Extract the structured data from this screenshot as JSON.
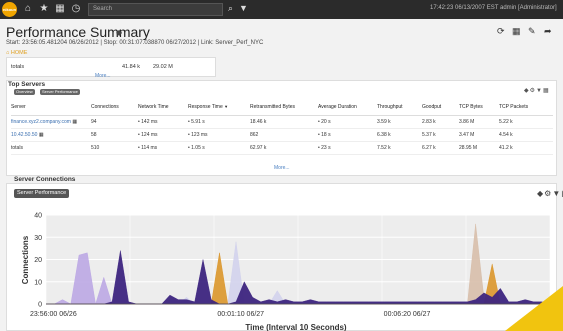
{
  "nav": {
    "logo_text": "nikoun",
    "search_placeholder": "Search",
    "clock": "17:42:23 06/13/2007 EST",
    "user": "admin [Administrator]"
  },
  "header": {
    "title": "Performance Summary",
    "subtitle": "Start: 23:56:05.481204 06/26/2012 | Stop: 00:31:07.038870 06/27/2012 | Link: Server_Perf_NYC",
    "crumb": "HOME"
  },
  "totals_strip": {
    "label": "totals",
    "v1": "41.84 k",
    "v2": "29.02 M",
    "more": "More..."
  },
  "top_servers": {
    "title": "Top Servers",
    "pills": [
      "Overview",
      "Server Performance"
    ],
    "columns": [
      "Server",
      "Connections",
      "Network Time",
      "Response Time",
      "Retransmitted Bytes",
      "Average Duration",
      "Throughput",
      "Goodput",
      "TCP Bytes",
      "TCP Packets"
    ],
    "rows": [
      [
        "finance.xyz2.company.com",
        "94",
        "142 ms",
        "5.91 s",
        "18.46 k",
        "20 s",
        "3.59 k",
        "2.83 k",
        "3.86 M",
        "5.22 k"
      ],
      [
        "10.42.50.50",
        "58",
        "124 ms",
        "123 ms",
        "862",
        "18 s",
        "6.38 k",
        "5.37 k",
        "3.47 M",
        "4.54 k"
      ],
      [
        "totals",
        "510",
        "114 ms",
        "1.05 s",
        "62.97 k",
        "23 s",
        "7.52 k",
        "6.27 k",
        "28.95 M",
        "41.2 k"
      ]
    ],
    "more": "More..."
  },
  "connections": {
    "section_title": "Server Connections",
    "tab": "Server Performance"
  },
  "chart_data": {
    "type": "area",
    "ylabel": "Connections",
    "xlabel": "Time (Interval 10 Seconds)",
    "ylim": [
      0,
      40
    ],
    "yticks": [
      0,
      10,
      20,
      30,
      40
    ],
    "xtick_labels": [
      "23:56:00 06/26",
      "00:01:10 06/27",
      "00:06:20 06/27"
    ],
    "grid": true,
    "series": [
      {
        "color": "#b9a3e3",
        "values": [
          0,
          0,
          2,
          0,
          22,
          23,
          0,
          12,
          0,
          0,
          0,
          0,
          0,
          0,
          0,
          0,
          0,
          0,
          0,
          0,
          0,
          0,
          0,
          0,
          0,
          0,
          0,
          0,
          0,
          0,
          0,
          0,
          0,
          0,
          0,
          0,
          0,
          0,
          0,
          0,
          0,
          0,
          0,
          0,
          0,
          0,
          0,
          0,
          0,
          0,
          0,
          0,
          0,
          0,
          0,
          0,
          0,
          0,
          0,
          0,
          0,
          0
        ]
      },
      {
        "color": "#d0d0ec",
        "values": [
          0,
          0,
          0,
          0,
          0,
          0,
          0,
          0,
          0,
          0,
          0,
          0,
          0,
          0,
          0,
          0,
          0,
          3,
          0,
          0,
          0,
          0,
          0,
          28,
          0,
          0,
          0,
          0,
          6,
          0,
          0,
          0,
          0,
          0,
          0,
          0,
          0,
          0,
          0,
          0,
          0,
          0,
          0,
          0,
          0,
          0,
          0,
          0,
          0,
          0,
          0,
          0,
          0,
          0,
          0,
          0,
          0,
          0,
          0,
          0,
          0,
          0
        ]
      },
      {
        "color": "#d6bba6",
        "values": [
          0,
          0,
          0,
          0,
          0,
          0,
          0,
          0,
          0,
          0,
          0,
          0,
          0,
          0,
          0,
          0,
          0,
          0,
          0,
          0,
          0,
          0,
          0,
          0,
          0,
          0,
          0,
          0,
          0,
          0,
          0,
          0,
          0,
          0,
          0,
          0,
          0,
          0,
          0,
          0,
          0,
          0,
          0,
          0,
          0,
          0,
          0,
          0,
          0,
          0,
          0,
          0,
          36,
          3,
          0,
          0,
          0,
          0,
          0,
          0,
          0,
          0
        ]
      },
      {
        "color": "#d9901f",
        "values": [
          0,
          0,
          0,
          0,
          0,
          0,
          0,
          0,
          0,
          0,
          0,
          0,
          0,
          0,
          0,
          0,
          0,
          0,
          0,
          0,
          0,
          23,
          0,
          0,
          0,
          0,
          0,
          0,
          0,
          0,
          0,
          0,
          0,
          0,
          0,
          0,
          0,
          0,
          0,
          0,
          0,
          0,
          0,
          0,
          0,
          0,
          0,
          0,
          0,
          0,
          0,
          0,
          0,
          0,
          18,
          0,
          0,
          0,
          0,
          0,
          0,
          0
        ]
      },
      {
        "color": "#3d2580",
        "values": [
          0,
          0,
          0,
          0,
          0,
          0,
          0,
          0,
          1,
          24,
          1,
          0,
          0,
          0,
          0,
          4,
          2,
          2,
          1,
          20,
          2,
          0,
          0,
          1,
          10,
          3,
          1,
          2,
          1,
          2,
          1,
          1,
          2,
          1,
          1,
          1,
          1,
          1,
          1,
          1,
          1,
          1,
          1,
          1,
          1,
          1,
          1,
          1,
          1,
          1,
          1,
          1,
          2,
          5,
          3,
          7,
          1,
          1,
          2,
          1,
          1,
          0
        ]
      }
    ]
  }
}
